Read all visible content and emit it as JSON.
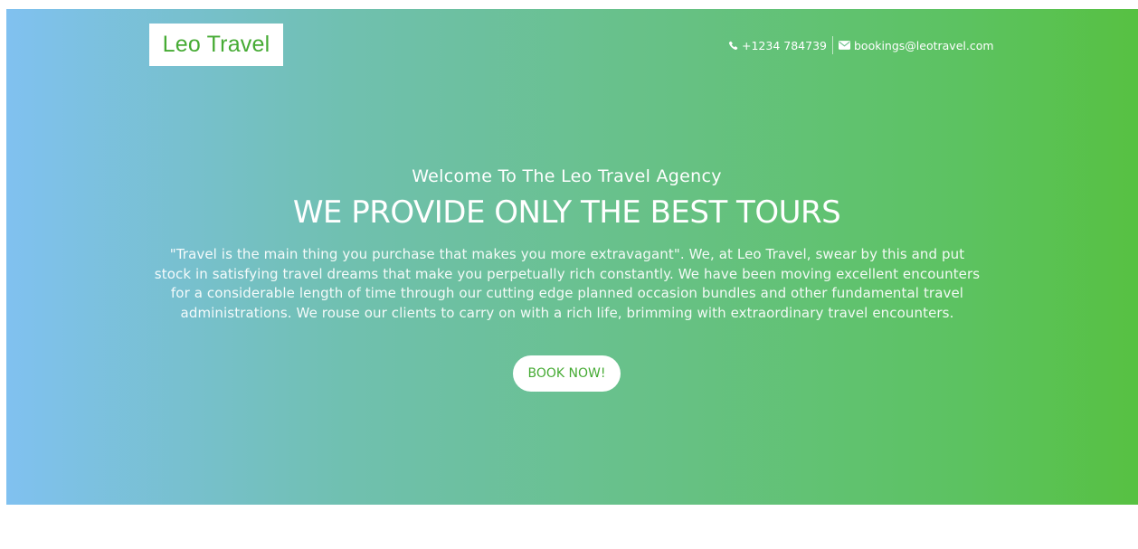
{
  "brand": {
    "logo_text": "Leo Travel",
    "color": "#46ab34"
  },
  "header": {
    "phone_icon": "phone-icon",
    "phone": "+1234 784739",
    "email_icon": "envelope-icon",
    "email": "bookings@leotravel.com"
  },
  "hero": {
    "welcome": "Welcome To The Leo Travel Agency",
    "headline": "WE PROVIDE ONLY THE BEST TOURS",
    "description": "\"Travel is the main thing you purchase that makes you more extravagant\". We, at Leo Travel, swear by this and put stock in satisfying travel dreams that make you perpetually rich constantly. We have been moving excellent encounters for a considerable length of time through our cutting edge planned occasion bundles and other fundamental travel administrations. We rouse our clients to carry on with a rich life, brimming with extraordinary travel encounters.",
    "cta_label": "BOOK NOW!",
    "gradient_start": "#80c1f0",
    "gradient_end": "#57c142"
  }
}
